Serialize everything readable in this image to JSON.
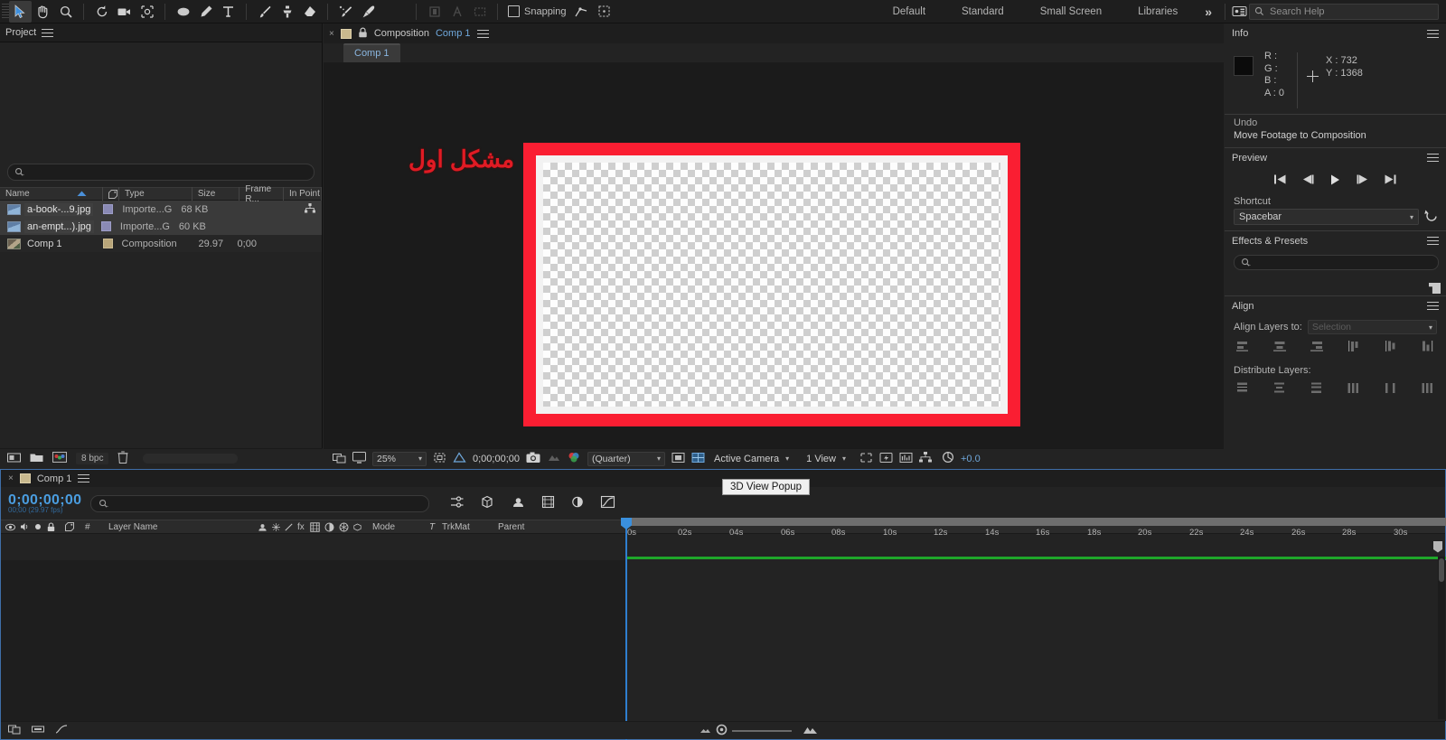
{
  "toolbar": {
    "tools": [
      {
        "name": "selection-tool",
        "icon": "arrow",
        "active": true
      },
      {
        "name": "hand-tool",
        "icon": "hand",
        "active": false
      },
      {
        "name": "zoom-tool",
        "icon": "magnifier",
        "active": false
      },
      {
        "name": "rotation-tool",
        "icon": "rotate",
        "active": false
      },
      {
        "name": "camera-tool",
        "icon": "camera",
        "active": false
      },
      {
        "name": "anchor-point-tool",
        "icon": "anchor",
        "active": false
      },
      {
        "name": "shape-tool",
        "icon": "ellipse",
        "active": false
      },
      {
        "name": "pen-tool",
        "icon": "pen",
        "active": false
      },
      {
        "name": "type-tool",
        "icon": "type-T",
        "active": false
      },
      {
        "name": "brush-tool",
        "icon": "brush",
        "active": false
      },
      {
        "name": "clone-stamp-tool",
        "icon": "stamp",
        "active": false
      },
      {
        "name": "eraser-tool",
        "icon": "eraser",
        "active": false
      },
      {
        "name": "roto-brush-tool",
        "icon": "roto-brush",
        "active": false
      },
      {
        "name": "puppet-pin-tool",
        "icon": "puppet-pin",
        "active": false
      }
    ],
    "snapping_label": "Snapping",
    "workspaces": [
      "Default",
      "Standard",
      "Small Screen",
      "Libraries"
    ],
    "more_workspaces": "»",
    "search_placeholder": "Search Help"
  },
  "project": {
    "title": "Project",
    "search_placeholder": "",
    "columns": [
      "Name",
      "Type",
      "Size",
      "Frame R...",
      "In Point"
    ],
    "rows": [
      {
        "name": "a-book-...9.jpg",
        "type": "Importe...G",
        "size": "68 KB",
        "frame_rate": "",
        "in_point": "",
        "selected": true,
        "kind": "footage"
      },
      {
        "name": "an-empt...).jpg",
        "type": "Importe...G",
        "size": "60 KB",
        "frame_rate": "",
        "in_point": "",
        "selected": true,
        "kind": "footage"
      },
      {
        "name": "Comp 1",
        "type": "Composition",
        "size": "",
        "frame_rate": "29.97",
        "in_point": "0;00",
        "selected": false,
        "kind": "comp"
      }
    ],
    "footer": {
      "bit_depth": "8 bpc"
    }
  },
  "composition": {
    "tab_close": "×",
    "header_label": "Composition",
    "header_comp_name": "Comp 1",
    "tab_name": "Comp 1",
    "canvas_overlay_text": "مشکل اول",
    "footer": {
      "zoom": "25%",
      "timecode": "0;00;00;00",
      "resolution": "(Quarter)",
      "camera": "Active Camera",
      "views": "1 View",
      "exposure": "+0.0"
    }
  },
  "info": {
    "title": "Info",
    "r_label": "R :",
    "g_label": "G :",
    "b_label": "B :",
    "a_label": "A :",
    "a_value": "0",
    "x_label": "X : 732",
    "y_label": "Y : 1368",
    "undo_title": "Undo",
    "undo_action": "Move Footage to Composition"
  },
  "preview": {
    "title": "Preview",
    "shortcut_label": "Shortcut",
    "shortcut_value": "Spacebar"
  },
  "effects_presets": {
    "title": "Effects & Presets",
    "search_placeholder": ""
  },
  "align": {
    "title": "Align",
    "align_layers_label": "Align Layers to:",
    "align_layers_value": "Selection",
    "distribute_label": "Distribute Layers:"
  },
  "timeline": {
    "tab_name": "Comp 1",
    "timecode": "0;00;00;00",
    "timecode_sub": "00;00 (29.97 fps)",
    "search_placeholder": "",
    "columns": [
      "#",
      "Layer Name",
      "Mode",
      "TrkMat",
      "Parent"
    ],
    "mode_label": "Mode",
    "trkmat_label": "TrkMat",
    "parent_label": "Parent",
    "layer_name_label": "Layer Name",
    "hash_label": "#",
    "ruler_ticks": [
      "0s",
      "02s",
      "04s",
      "06s",
      "08s",
      "10s",
      "12s",
      "14s",
      "16s",
      "18s",
      "20s",
      "22s",
      "24s",
      "26s",
      "28s",
      "30s"
    ]
  },
  "tooltip": {
    "text": "3D View Popup"
  },
  "colors": {
    "accent_blue": "#4a9de0",
    "red_frame": "#fa1e32",
    "persian_text": "#e01b24",
    "green_bar": "#1ea62a",
    "panel_bg": "#232323",
    "toolbar_bg": "#1e1e1e"
  }
}
